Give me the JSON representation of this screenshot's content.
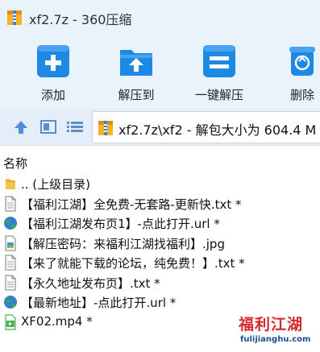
{
  "window": {
    "title": "xf2.7z - 360压缩"
  },
  "toolbar": {
    "items": [
      {
        "label": "添加",
        "icon": "add-archive-icon"
      },
      {
        "label": "解压到",
        "icon": "extract-to-icon"
      },
      {
        "label": "一键解压",
        "icon": "one-click-extract-icon"
      },
      {
        "label": "删除",
        "icon": "delete-icon"
      }
    ]
  },
  "pathbar": {
    "path": "xf2.7z\\xf2 - 解包大小为 604.4 M"
  },
  "list": {
    "header": "名称",
    "items": [
      {
        "name": ".. (上级目录)",
        "icon": "parent-folder-icon"
      },
      {
        "name": "【福利江湖】全免费-无套路-更新快.txt *",
        "icon": "text-file-icon"
      },
      {
        "name": "【福利江湖发布页1】-点此打开.url *",
        "icon": "globe-url-icon"
      },
      {
        "name": "【解压密码：来福利江湖找福利】.jpg",
        "icon": "image-file-icon"
      },
      {
        "name": "【来了就能下载的论坛，纯免费！】.txt *",
        "icon": "text-file-icon"
      },
      {
        "name": "【永久地址发布页】.txt *",
        "icon": "text-file-icon"
      },
      {
        "name": "【最新地址】-点此打开.url *",
        "icon": "globe-url-icon"
      },
      {
        "name": "XF02.mp4 *",
        "icon": "video-file-icon"
      }
    ]
  },
  "watermark": {
    "text": "福利江湖",
    "url": "fulijianghu.com"
  },
  "colors": {
    "accent": "#1e88e5",
    "toolbar_bg": "#e9f3fc"
  }
}
